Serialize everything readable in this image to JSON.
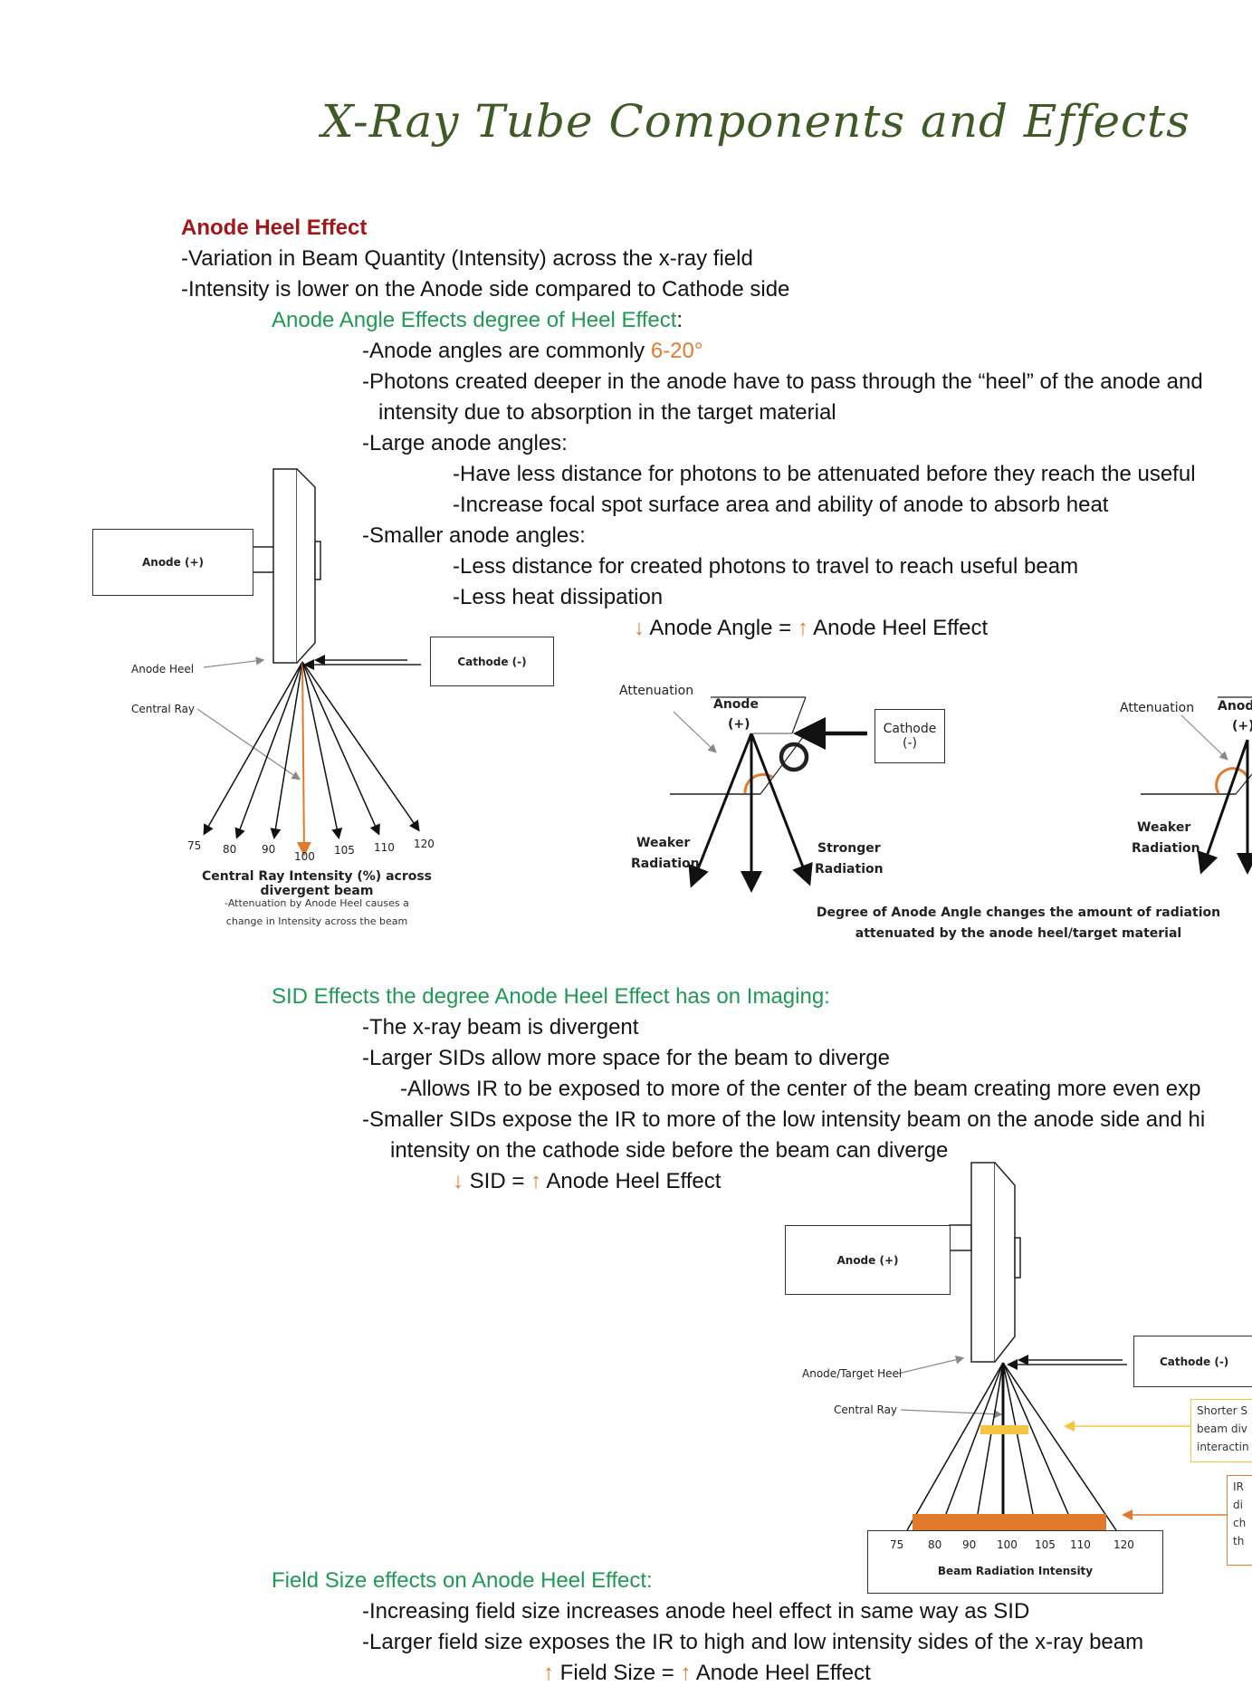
{
  "page": {
    "title": "X-Ray Tube Components and Effects"
  },
  "heel_section": {
    "heading": "Anode Heel Effect",
    "lines": [
      "-Variation in Beam Quantity (Intensity) across the x-ray field",
      "-Intensity is lower on the Anode side compared to Cathode side"
    ],
    "subheading": "Anode Angle Effects degree of Heel Effect",
    "subheading_colon": ":",
    "angle_prefix": "-Anode angles are commonly ",
    "angle_value": "6-20°",
    "photons_line1": "-Photons created deeper in the anode have to pass through the “heel” of the anode and",
    "photons_line2": "intensity due to absorption in the target material",
    "large_heading": "-Large anode angles:",
    "large_items": [
      "-Have less distance for photons to be attenuated before they reach the useful",
      "-Increase focal spot surface area and ability of anode to absorb heat"
    ],
    "small_heading": "-Smaller anode angles:",
    "small_items": [
      "-Less distance for created photons to travel to reach useful beam",
      "-Less heat dissipation"
    ],
    "rule": {
      "down_arrow": "↓",
      "left": " Anode Angle = ",
      "up_arrow": "↑",
      "right": " Anode Heel Effect"
    }
  },
  "diagram1": {
    "anode_label": "Anode (+)",
    "cathode_label": "Cathode (-)",
    "anode_heel_label": "Anode Heel",
    "central_ray_label": "Central Ray",
    "intensities": [
      "75",
      "80",
      "90",
      "100",
      "105",
      "110",
      "120"
    ],
    "caption": "Central Ray Intensity (%) across divergent beam",
    "note": "-Attenuation by Anode Heel causes a change in Intensity across the beam"
  },
  "diagram2": {
    "attenuation_label": "Attenuation",
    "anode_label_1": "Anode",
    "anode_label_2": "(+)",
    "cathode_label_1": "Cathode",
    "cathode_label_2": "(-)",
    "weaker_1": "Weaker",
    "weaker_2": "Radiation",
    "stronger_1": "Stronger",
    "stronger_2": "Radiation",
    "caption_1": "Degree of Anode Angle changes the amount of radiation",
    "caption_2": "attenuated by the anode heel/target material"
  },
  "diagram3": {
    "attenuation_label": "Attenuation",
    "anode_label_1": "Anod",
    "anode_label_2": "(+)",
    "weaker_1": "Weaker",
    "weaker_2": "Radiation"
  },
  "sid_section": {
    "heading": "SID Effects the degree Anode Heel Effect has on Imaging:",
    "lines": [
      "-The x-ray beam is divergent",
      "-Larger SIDs allow more space for the beam to diverge"
    ],
    "sub_line": "-Allows IR to be exposed to more of the center of the beam creating more even exp",
    "smaller_line1": "-Smaller SIDs expose the IR to more of the low intensity beam on the anode side and hi",
    "smaller_line2": "intensity on the cathode side before the beam can diverge",
    "rule": {
      "down_arrow": "↓",
      "left": " SID = ",
      "up_arrow": "↑",
      "right": " Anode Heel Effect"
    }
  },
  "diagram4": {
    "anode_label": "Anode (+)",
    "cathode_label": "Cathode (-)",
    "heel_label": "Anode/Target Heel",
    "central_ray_label": "Central Ray",
    "intensities": [
      "75",
      "80",
      "90",
      "100",
      "105",
      "110",
      "120"
    ],
    "caption": "Beam Radiation Intensity",
    "callout_short_sid": [
      "Shorter S",
      "beam div",
      "interactin"
    ],
    "callout_ir": [
      "IR",
      "di",
      "ch",
      "th"
    ],
    "colors": {
      "short_sid": "#f5c542",
      "ir": "#e07b2e"
    }
  },
  "field_section": {
    "heading": "Field Size effects on Anode Heel Effect:",
    "lines": [
      "-Increasing field size increases anode heel effect in same way as SID",
      "-Larger field size exposes the IR to high and low intensity sides of the x-ray beam"
    ],
    "rule": {
      "up_arrow_1": "↑",
      "left": " Field Size = ",
      "up_arrow_2": "↑",
      "right": " Anode Heel Effect"
    }
  },
  "colors": {
    "title": "#3f5a26",
    "heading_red": "#a3161a",
    "subheading_green": "#1f9a55",
    "accent_orange": "#e07b2e"
  }
}
